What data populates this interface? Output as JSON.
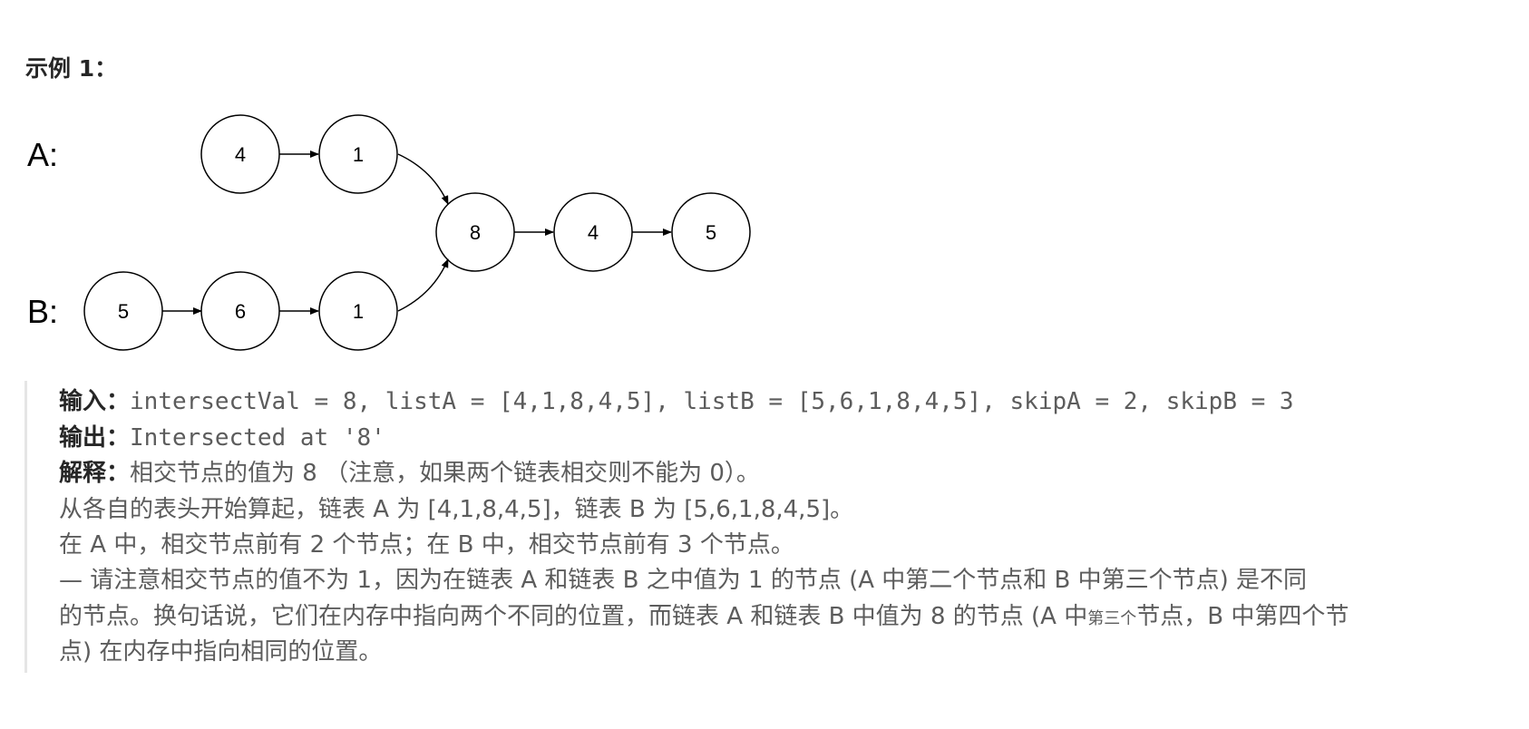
{
  "heading": "示例 1：",
  "diagram": {
    "row_a_label": "A:",
    "row_b_label": "B:",
    "list_a_nodes": [
      "4",
      "1"
    ],
    "list_b_nodes": [
      "5",
      "6",
      "1"
    ],
    "shared_nodes": [
      "8",
      "4",
      "5"
    ]
  },
  "example": {
    "input_label": "输入：",
    "input_value": "intersectVal = 8, listA = [4,1,8,4,5], listB = [5,6,1,8,4,5], skipA = 2, skipB = 3",
    "output_label": "输出：",
    "output_value": "Intersected at '8'",
    "explain_label": "解释：",
    "explain_text": "相交节点的值为 8 （注意，如果两个链表相交则不能为 0）。",
    "line2": "从各自的表头开始算起，链表 A 为 [4,1,8,4,5]，链表 B 为 [5,6,1,8,4,5]。",
    "line3": "在 A 中，相交节点前有 2 个节点；在 B 中，相交节点前有 3 个节点。",
    "line4": "— 请注意相交节点的值不为 1，因为在链表 A 和链表 B 之中值为 1 的节点 (A 中第二个节点和 B 中第三个节点) 是不同",
    "line5_part1": "的节点。换句话说，它们在内存中指向两个不同的位置，而链表 A 和链表 B 中值为 8 的节点 (A 中",
    "line5_small": "第三个",
    "line5_part2": "节点，B 中第四个节",
    "line6": "点) 在内存中指向相同的位置。"
  }
}
